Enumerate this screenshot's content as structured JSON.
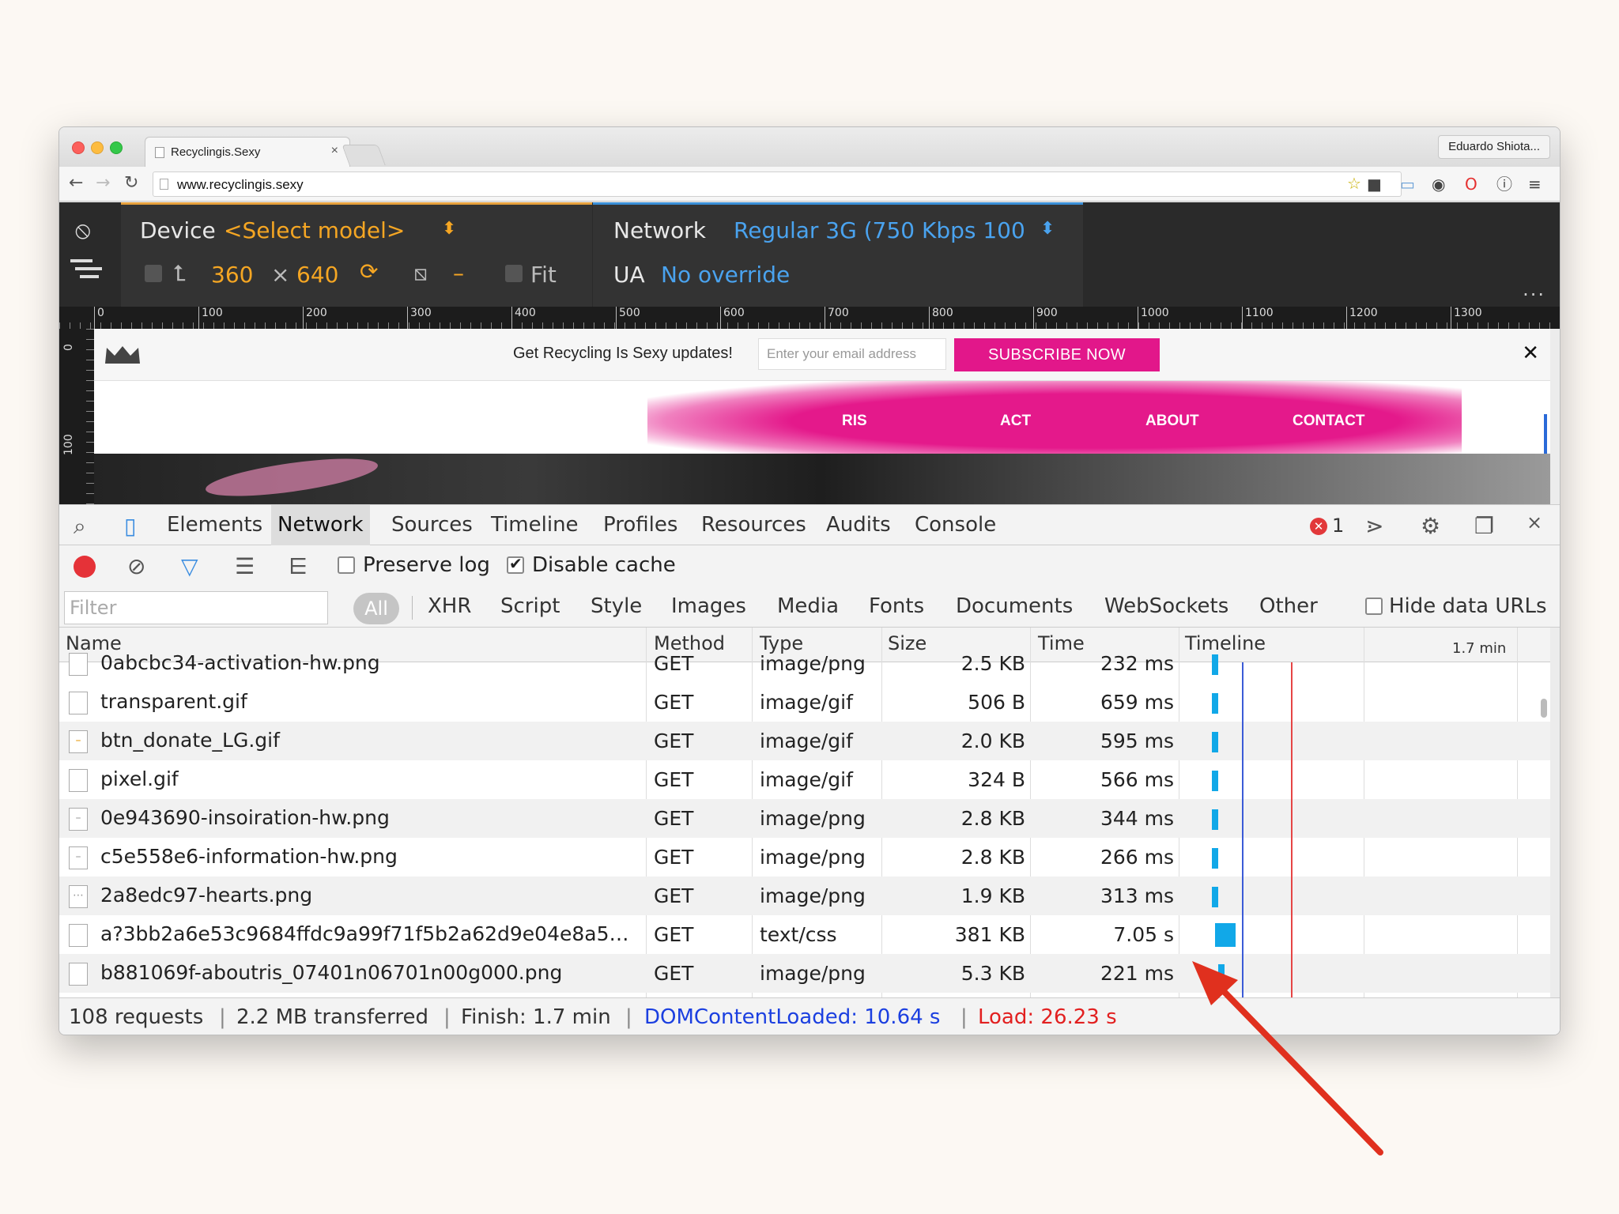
{
  "browser": {
    "tab_title": "Recyclingis.Sexy",
    "tab_close": "×",
    "profile_name": "Eduardo Shiota...",
    "url": "www.recyclingis.sexy"
  },
  "device_mode": {
    "device_label": "Device",
    "model_select": "<Select model>",
    "width": "360",
    "times": "×",
    "height": "640",
    "zoom_dash": "–",
    "fit_label": "Fit",
    "network_label": "Network",
    "network_select": "Regular 3G (750 Kbps 100",
    "ua_label": "UA",
    "ua_value": "No override",
    "more": "..."
  },
  "ruler": {
    "ticks": [
      "0",
      "100",
      "200",
      "300",
      "400",
      "500",
      "600",
      "700",
      "800",
      "900",
      "1000",
      "1100",
      "1200",
      "1300"
    ],
    "v_ticks": [
      "0",
      "100"
    ]
  },
  "site": {
    "promo_text": "Get Recycling Is Sexy updates!",
    "email_placeholder": "Enter your email address",
    "subscribe_label": "SUBSCRIBE NOW",
    "close_label": "✕",
    "nav": [
      "RIS",
      "ACT",
      "ABOUT",
      "CONTACT"
    ]
  },
  "devtools": {
    "tabs": [
      "Elements",
      "Network",
      "Sources",
      "Timeline",
      "Profiles",
      "Resources",
      "Audits",
      "Console"
    ],
    "active_tab": "Network",
    "error_count": "1",
    "close_label": "×"
  },
  "network": {
    "preserve_log": "Preserve log",
    "preserve_log_checked": false,
    "disable_cache": "Disable cache",
    "disable_cache_checked": true,
    "filter_placeholder": "Filter",
    "types": [
      "All",
      "XHR",
      "Script",
      "Style",
      "Images",
      "Media",
      "Fonts",
      "Documents",
      "WebSockets",
      "Other"
    ],
    "active_type": "All",
    "hide_data_urls": "Hide data URLs",
    "columns": {
      "name": "Name",
      "method": "Method",
      "type": "Type",
      "size": "Size",
      "time": "Time",
      "timeline": "Timeline",
      "timeline_scale": "1.7 min"
    },
    "rows": [
      {
        "name": "0abcbc34-activation-hw.png",
        "method": "GET",
        "type": "image/png",
        "size": "2.5 KB",
        "time": "232 ms"
      },
      {
        "name": "transparent.gif",
        "method": "GET",
        "type": "image/gif",
        "size": "506 B",
        "time": "659 ms"
      },
      {
        "name": "btn_donate_LG.gif",
        "method": "GET",
        "type": "image/gif",
        "size": "2.0 KB",
        "time": "595 ms"
      },
      {
        "name": "pixel.gif",
        "method": "GET",
        "type": "image/gif",
        "size": "324 B",
        "time": "566 ms"
      },
      {
        "name": "0e943690-insoiration-hw.png",
        "method": "GET",
        "type": "image/png",
        "size": "2.8 KB",
        "time": "344 ms"
      },
      {
        "name": "c5e558e6-information-hw.png",
        "method": "GET",
        "type": "image/png",
        "size": "2.8 KB",
        "time": "266 ms"
      },
      {
        "name": "2a8edc97-hearts.png",
        "method": "GET",
        "type": "image/png",
        "size": "1.9 KB",
        "time": "313 ms"
      },
      {
        "name": "a?3bb2a6e53c9684ffdc9a99f71f5b2a62d9e04e8a5a...",
        "method": "GET",
        "type": "text/css",
        "size": "381 KB",
        "time": "7.05 s"
      },
      {
        "name": "b881069f-aboutris_07401n06701n00g000.png",
        "method": "GET",
        "type": "image/png",
        "size": "5.3 KB",
        "time": "221 ms"
      }
    ],
    "status": {
      "requests": "108 requests",
      "transferred": "2.2 MB transferred",
      "finish": "Finish: 1.7 min",
      "dom_content_loaded": "DOMContentLoaded: 10.64 s",
      "load": "Load: 26.23 s",
      "separator": "|"
    }
  },
  "colors": {
    "accent_pink": "#e2178a",
    "device_orange": "#f5a623",
    "network_blue": "#4aa3ef",
    "dom_blue": "#1b3fe0",
    "load_red": "#e22020",
    "annotation_arrow": "#e0301e"
  }
}
